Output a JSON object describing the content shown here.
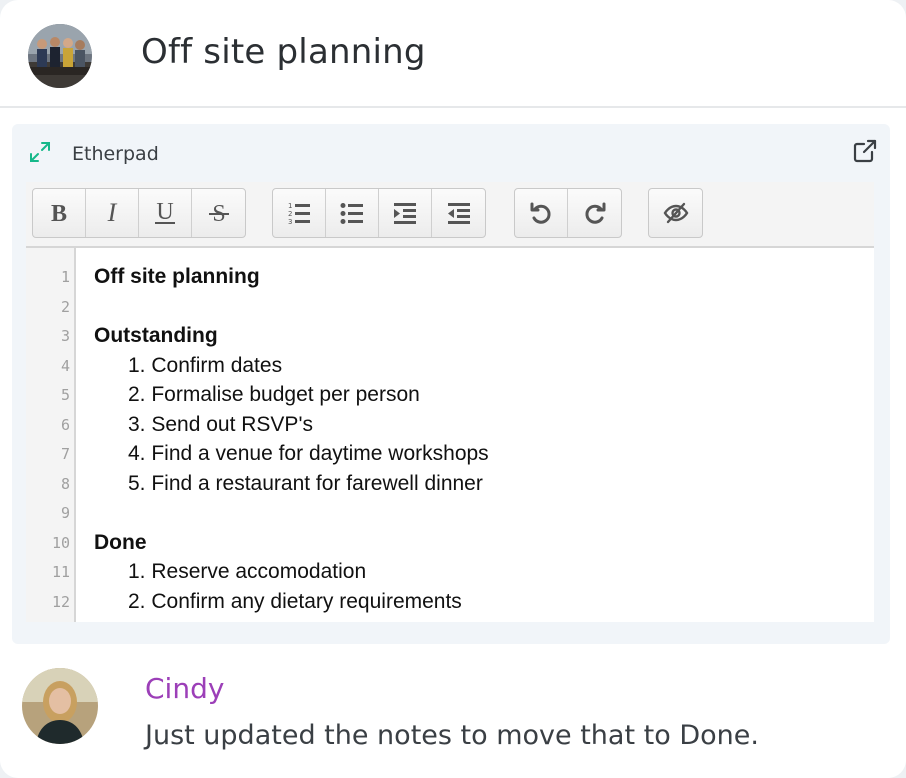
{
  "header": {
    "title": "Off site planning"
  },
  "embed": {
    "label": "Etherpad",
    "toolbar": {
      "format": [
        "bold",
        "italic",
        "underline",
        "strikethrough"
      ],
      "lists": [
        "ordered-list",
        "unordered-list",
        "indent",
        "outdent"
      ],
      "history": [
        "undo",
        "redo"
      ],
      "view": [
        "hide-authorship"
      ]
    },
    "lines": [
      {
        "n": "1",
        "text": "Off site planning",
        "style": "bold"
      },
      {
        "n": "2",
        "text": "",
        "style": "plain"
      },
      {
        "n": "3",
        "text": "Outstanding",
        "style": "bold"
      },
      {
        "n": "4",
        "text": "1. Confirm dates",
        "style": "item"
      },
      {
        "n": "5",
        "text": "2. Formalise budget per person",
        "style": "item"
      },
      {
        "n": "6",
        "text": "3. Send out RSVP's",
        "style": "item"
      },
      {
        "n": "7",
        "text": "4. Find a venue for daytime workshops",
        "style": "item"
      },
      {
        "n": "8",
        "text": "5. Find a restaurant for farewell dinner",
        "style": "item"
      },
      {
        "n": "9",
        "text": "",
        "style": "plain"
      },
      {
        "n": "10",
        "text": "Done",
        "style": "bold"
      },
      {
        "n": "11",
        "text": "1. Reserve accomodation",
        "style": "item"
      },
      {
        "n": "12",
        "text": "2. Confirm any dietary requirements",
        "style": "item"
      }
    ]
  },
  "comment": {
    "author": "Cindy",
    "message": "Just updated the notes to move that to Done."
  },
  "colors": {
    "accent": "#16b88a",
    "author": "#9c3fb8"
  }
}
